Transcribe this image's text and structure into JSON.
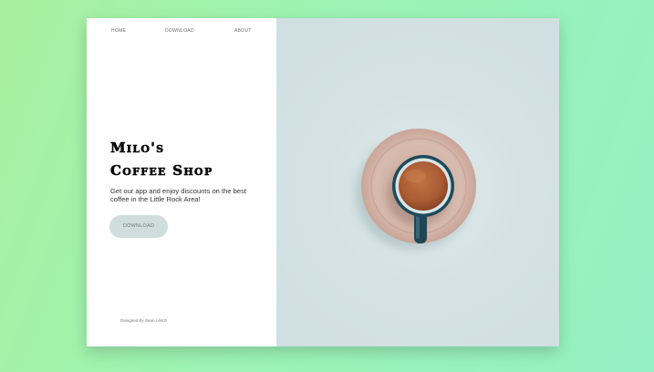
{
  "nav": {
    "items": [
      "HOME",
      "DOWNLOAD",
      "ABOUT"
    ]
  },
  "hero": {
    "title_line1": "Milo's",
    "title_line2": "Coffee Shop",
    "description": "Get our app and enjoy discounts on the best coffee in the Little Rock Area!",
    "button_label": "DOWNLOAD"
  },
  "footer": {
    "credit": "Designed by Sean Leitch"
  },
  "image": {
    "subject": "cup-of-coffee-on-saucer-image"
  },
  "colors": {
    "background_gradient_start": "#a8f0a0",
    "background_gradient_end": "#95f0c4",
    "button_bg": "#cfdedd",
    "image_bg": "#d4e2e4"
  }
}
